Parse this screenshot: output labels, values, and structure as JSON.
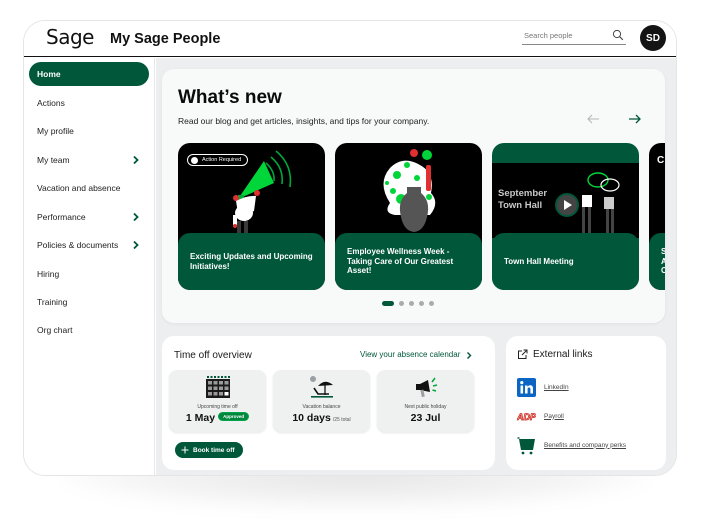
{
  "header": {
    "logo": "Sage",
    "app_title": "My Sage People",
    "search_placeholder": "Search people",
    "avatar_initials": "SD"
  },
  "sidebar": {
    "items": [
      {
        "label": "Home",
        "active": true,
        "has_submenu": false
      },
      {
        "label": "Actions",
        "active": false,
        "has_submenu": false
      },
      {
        "label": "My profile",
        "active": false,
        "has_submenu": false
      },
      {
        "label": "My team",
        "active": false,
        "has_submenu": true
      },
      {
        "label": "Vacation and absence",
        "active": false,
        "has_submenu": false
      },
      {
        "label": "Performance",
        "active": false,
        "has_submenu": true
      },
      {
        "label": "Policies & documents",
        "active": false,
        "has_submenu": true
      },
      {
        "label": "Hiring",
        "active": false,
        "has_submenu": false
      },
      {
        "label": "Training",
        "active": false,
        "has_submenu": false
      },
      {
        "label": "Org chart",
        "active": false,
        "has_submenu": false
      }
    ]
  },
  "whats_new": {
    "title": "What’s new",
    "subtitle": "Read our blog and get articles, insights, and tips for your company.",
    "cards": [
      {
        "title": "Exciting Updates and Upcoming Initiatives!",
        "badge": "Action Required",
        "art": "megaphone-illustration"
      },
      {
        "title": "Employee Wellness Week - Taking Care of Our Greatest Asset!",
        "art": "vase-flowers-illustration"
      },
      {
        "title": "Town Hall Meeting",
        "art_text": "September Town Hall",
        "art": "town-hall-video-thumbnail"
      },
      {
        "title": "S A C",
        "art_text": "C",
        "art": "partial-card"
      }
    ],
    "pagination": {
      "total": 5,
      "current": 1
    }
  },
  "time_off": {
    "title": "Time off overview",
    "calendar_link": "View your absence calendar",
    "tiles": [
      {
        "label": "Upcoming time off",
        "value": "1 May",
        "badge": "Approved",
        "icon": "calendar-icon"
      },
      {
        "label": "Vacation balance",
        "value": "10 days",
        "suffix": "/25 total",
        "icon": "beach-chair-icon"
      },
      {
        "label": "Next public holiday",
        "value": "23 Jul",
        "icon": "megaphone-icon"
      }
    ],
    "book_button": "Book time off"
  },
  "external_links": {
    "title": "External links",
    "links": [
      {
        "label": "LinkedIn",
        "icon": "linkedin-icon"
      },
      {
        "label": "Payroll",
        "icon": "adp-icon"
      },
      {
        "label": "Benefits and company perks",
        "icon": "shopping-cart-icon"
      }
    ]
  },
  "colors": {
    "brand_green": "#00573a",
    "accent_green": "#00d639",
    "approved_green": "#00873d",
    "background": "#eceeef",
    "linkedin_blue": "#0a66c2",
    "adp_red": "#d0271d"
  }
}
